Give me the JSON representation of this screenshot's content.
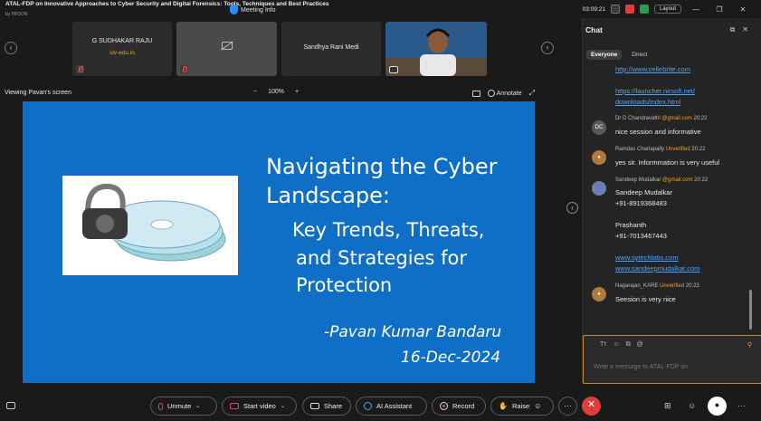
{
  "window": {
    "title": "ATAL-FDP on Innovative Approaches to Cyber Security and Digital Forensics: Tools, Techniques and Best Practices",
    "subtitle": "by PRSON",
    "meeting_info": "Meeting Info",
    "timer": "03:09:21",
    "layout_label": "Layout"
  },
  "gallery": {
    "tiles": [
      {
        "name": "G SUDHAKAR RAJU",
        "sub": "slv-edu.in"
      },
      {
        "name": "",
        "sub": ""
      },
      {
        "name": "Sandhya Rani Medi",
        "sub": ""
      },
      {
        "name": "",
        "sub": ""
      }
    ]
  },
  "view": {
    "viewing_label": "Viewing Pavan's screen",
    "zoom_minus": "−",
    "zoom_level": "100%",
    "zoom_plus": "+",
    "annotate_label": "Annotate"
  },
  "slide": {
    "title_line1": "Navigating the Cyber",
    "title_line2": "Landscape:",
    "sub_line1": "Key Trends, Threats,",
    "sub_line2": "and Strategies for",
    "sub_line3": "Protection",
    "author": "-Pavan Kumar Bandaru",
    "date": "16-Dec-2024",
    "colors": {
      "background": "#0f6fc6",
      "text": "#ffffff"
    }
  },
  "chat": {
    "title": "Chat",
    "tabs": [
      "Everyone",
      "Direct"
    ],
    "messages": [
      {
        "lines": [
          "http://www.cellebrite.com"
        ],
        "type": "link"
      },
      {
        "lines": [
          "https://launcher.nirsoft.net/",
          "downloads/index.html"
        ],
        "type": "link"
      },
      {
        "avatar": "DC",
        "sender": "Dr D Chandravathi",
        "email": "@gmail.com",
        "time": "20:22",
        "lines": [
          "nice session and informative"
        ]
      },
      {
        "sender": "Ramdas Charlapally",
        "unverified": "Unverified",
        "time": "20:22",
        "lines": [
          "yes sir. Informmation is very useful"
        ]
      },
      {
        "sender": "Sandeep Mudalkar",
        "email": "@gmail.com",
        "time": "20:22",
        "lines": [
          "Sandeep Mudalkar",
          "+91-8919368483",
          "Prashanth",
          "+91-7013467443"
        ],
        "links": [
          "www.sytechlabs.com",
          "www.sandeepmudalkar.com"
        ]
      },
      {
        "sender": "Nagarajan_KARE",
        "unverified": "Unverified",
        "time": "20:23",
        "lines": [
          "Seesion is very nice"
        ]
      }
    ],
    "compose_placeholder": "Write a message to ATAL-FDP on",
    "compose_tools": [
      "Tт",
      "☺",
      "⧉",
      "@"
    ]
  },
  "toolbar": {
    "unmute": "Unmute",
    "start_video": "Start video",
    "share": "Share",
    "ai_assistant": "AI Assistant",
    "record": "Record",
    "raise": "Raise",
    "more": "···",
    "leave": "✕"
  }
}
